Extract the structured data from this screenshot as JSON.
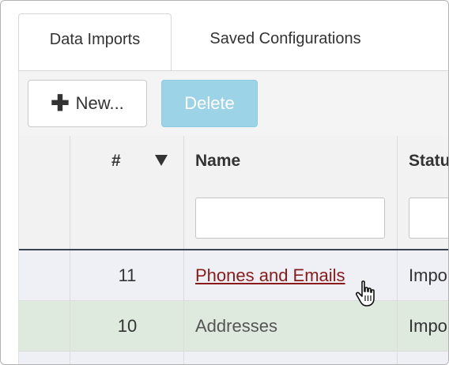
{
  "tabs": [
    {
      "label": "Data Imports",
      "active": true
    },
    {
      "label": "Saved Configurations",
      "active": false
    }
  ],
  "toolbar": {
    "new_label": "New...",
    "new_icon": "plus-icon",
    "delete_label": "Delete"
  },
  "table": {
    "columns": [
      {
        "label": "#",
        "sort": "descending",
        "sort_icon": "sort-down-triangle-icon"
      },
      {
        "label": "Name"
      },
      {
        "label": "Statu"
      }
    ],
    "filters": {
      "name": "",
      "status": ""
    },
    "rows": [
      {
        "num": "11",
        "name": "Phones and Emails",
        "status": "Impo",
        "hovered": true
      },
      {
        "num": "10",
        "name": "Addresses",
        "status": "Impo",
        "hovered": false
      }
    ]
  },
  "colors": {
    "header_border": "#3b4455",
    "delete_button": "#9dd3e6",
    "link": "#8b1a1a",
    "row_selected": "#deeadd",
    "row_default": "#eef0f6"
  },
  "cursor_icon": "hand-pointer-icon"
}
